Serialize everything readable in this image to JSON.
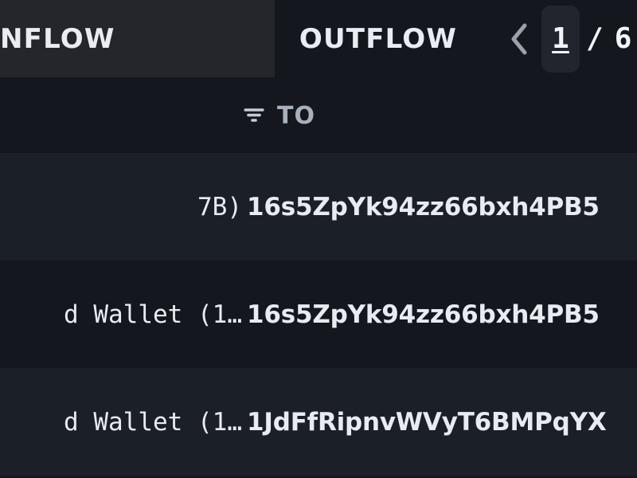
{
  "tabs": [
    {
      "id": "inflow",
      "label": "NFLOW",
      "active": true
    },
    {
      "id": "outflow",
      "label": "OUTFLOW",
      "active": false
    }
  ],
  "pager": {
    "prev_icon": "chevron-left-icon",
    "current_page": "1",
    "separator": "/",
    "total_pages": "6"
  },
  "table": {
    "columns": [
      {
        "id": "from",
        "label": "",
        "filter_icon": ""
      },
      {
        "id": "to",
        "label": "TO",
        "filter_icon": "filter-icon"
      }
    ],
    "rows": [
      {
        "from": "7B)",
        "to": "16s5ZpYk94zz66bxh4PB5"
      },
      {
        "from": "d Wallet (1…",
        "to": "16s5ZpYk94zz66bxh4PB5"
      },
      {
        "from": "d Wallet (1…",
        "to": "1JdFfRipnvWVyT6BMPqYX"
      }
    ]
  },
  "colors": {
    "background": "#14171e",
    "active_tab": "#24262c",
    "row_alt": "#1b1f28",
    "text_primary": "#e8ebf1",
    "text_muted": "#a9b0bd",
    "input_bg": "#22252d"
  }
}
